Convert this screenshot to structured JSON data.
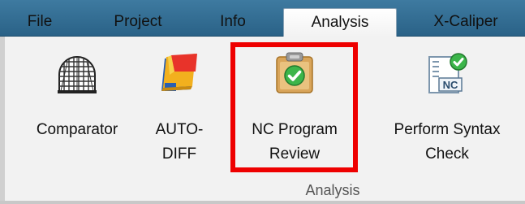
{
  "menu": {
    "tabs": [
      {
        "label": "File"
      },
      {
        "label": "Project"
      },
      {
        "label": "Info"
      },
      {
        "label": "Analysis",
        "active": true
      },
      {
        "label": "X-Caliper"
      }
    ]
  },
  "ribbon": {
    "commands": [
      {
        "label": "Comparator",
        "icon": "comparator-grid-icon"
      },
      {
        "label": "AUTO-\nDIFF",
        "icon": "auto-diff-icon"
      },
      {
        "label": "NC Program\nReview",
        "icon": "clipboard-check-icon",
        "highlighted": true
      },
      {
        "label": "Perform Syntax\nCheck",
        "icon": "nc-syntax-check-icon",
        "icon_text": "NC"
      }
    ],
    "group_label": "Analysis"
  },
  "colors": {
    "tabbar_bg": "#2a6287",
    "highlight": "#ee0000",
    "check_green": "#3cb54a"
  }
}
